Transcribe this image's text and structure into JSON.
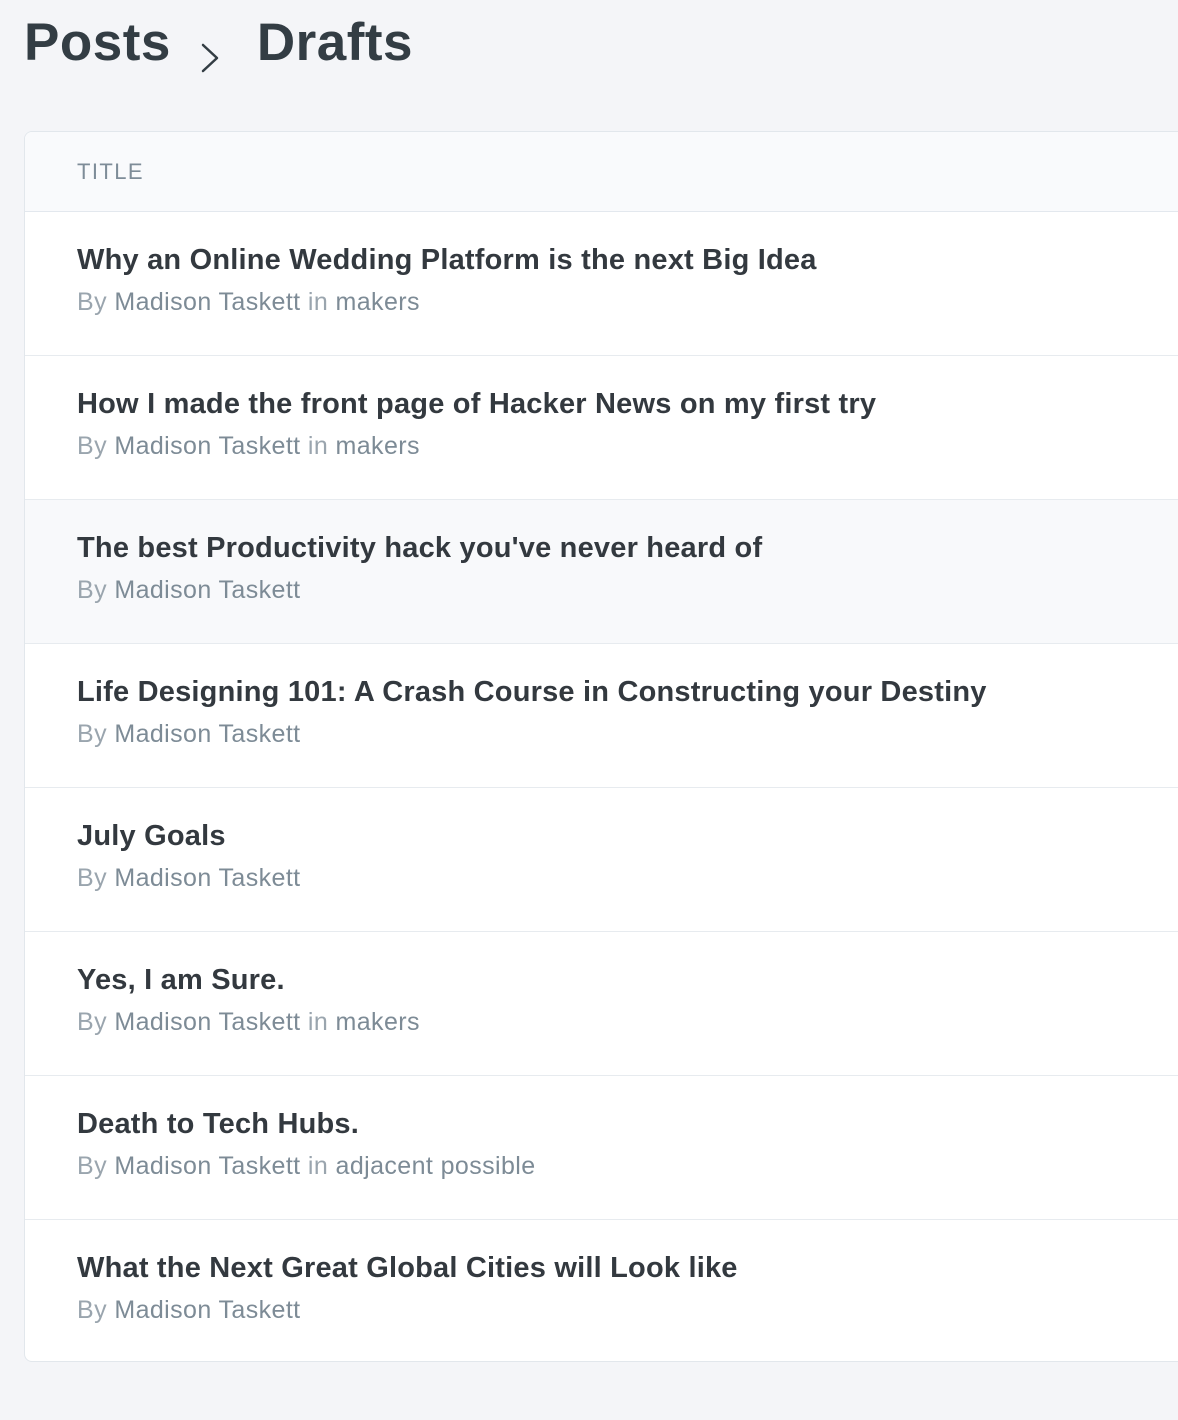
{
  "breadcrumb": {
    "parent": "Posts",
    "separator_icon": "chevron-right-icon",
    "current": "Drafts"
  },
  "table": {
    "header": "TITLE",
    "rows": [
      {
        "title": "Why an Online Wedding Platform is the next Big Idea",
        "by": "By",
        "author": "Madison Taskett",
        "in": "in",
        "publication": "makers"
      },
      {
        "title": "How I made the front page of Hacker News on my first try",
        "by": "By",
        "author": "Madison Taskett",
        "in": "in",
        "publication": "makers"
      },
      {
        "title": "The best Productivity hack you've never heard of",
        "by": "By",
        "author": "Madison Taskett"
      },
      {
        "title": "Life Designing 101: A Crash Course in Constructing your Destiny",
        "by": "By",
        "author": "Madison Taskett"
      },
      {
        "title": "July Goals",
        "by": "By",
        "author": "Madison Taskett"
      },
      {
        "title": "Yes, I am Sure.",
        "by": "By",
        "author": "Madison Taskett",
        "in": "in",
        "publication": "makers"
      },
      {
        "title": "Death to Tech Hubs.",
        "by": "By",
        "author": "Madison Taskett",
        "in": "in",
        "publication": "adjacent possible"
      },
      {
        "title": "What the Next Great Global Cities will Look like",
        "by": "By",
        "author": "Madison Taskett"
      }
    ]
  },
  "colors": {
    "background": "#f4f5f8",
    "card": "#ffffff",
    "title_text": "#33393f",
    "meta_text": "#9aa5ae",
    "meta_link": "#7d8b96",
    "hover_row": "#f8f9fb"
  }
}
